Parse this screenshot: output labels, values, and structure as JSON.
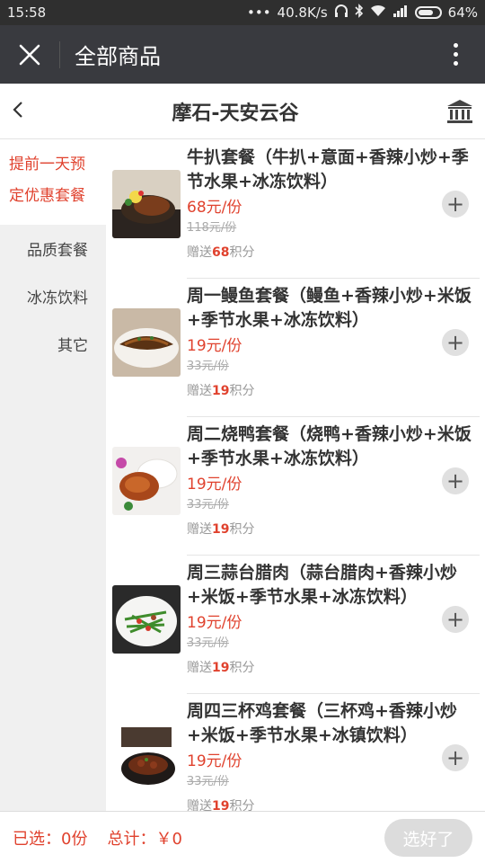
{
  "status_bar": {
    "time": "15:58",
    "speed": "40.8K/s",
    "battery": "64%"
  },
  "titlebar": {
    "title": "全部商品",
    "close_icon": "close-icon",
    "more_icon": "more-vertical-icon"
  },
  "store": {
    "name": "摩石-天安云谷",
    "back_icon": "chevron-left-icon",
    "bank_icon": "bank-icon"
  },
  "categories": [
    {
      "label": "提前一天预",
      "active": true
    },
    {
      "label": "定优惠套餐",
      "active": true
    },
    {
      "label": "品质套餐",
      "active": false
    },
    {
      "label": "冰冻饮料",
      "active": false
    },
    {
      "label": "其它",
      "active": false
    }
  ],
  "products": [
    {
      "name": "牛扒套餐（牛扒+意面+香辣小炒+季节水果+冰冻饮料）",
      "price": "68元/份",
      "orig": "118元/份",
      "points_prefix": "赠送",
      "points": "68",
      "points_suffix": "积分"
    },
    {
      "name": "周一鳗鱼套餐（鳗鱼+香辣小炒+米饭+季节水果+冰冻饮料）",
      "price": "19元/份",
      "orig": "33元/份",
      "points_prefix": "赠送",
      "points": "19",
      "points_suffix": "积分"
    },
    {
      "name": "周二烧鸭套餐（烧鸭+香辣小炒+米饭+季节水果+冰冻饮料）",
      "price": "19元/份",
      "orig": "33元/份",
      "points_prefix": "赠送",
      "points": "19",
      "points_suffix": "积分"
    },
    {
      "name": "周三蒜台腊肉（蒜台腊肉+香辣小炒+米饭+季节水果+冰冻饮料）",
      "price": "19元/份",
      "orig": "33元/份",
      "points_prefix": "赠送",
      "points": "19",
      "points_suffix": "积分"
    },
    {
      "name": "周四三杯鸡套餐（三杯鸡+香辣小炒+米饭+季节水果+冰镇饮料）",
      "price": "19元/份",
      "orig": "33元/份",
      "points_prefix": "赠送",
      "points": "19",
      "points_suffix": "积分"
    }
  ],
  "bottom": {
    "selected": "已选：0份",
    "total": "总计：￥0",
    "done_label": "选好了"
  },
  "colors": {
    "accent": "#e0422e",
    "titlebar": "#393a3f",
    "statusbar": "#2f2f2f"
  }
}
